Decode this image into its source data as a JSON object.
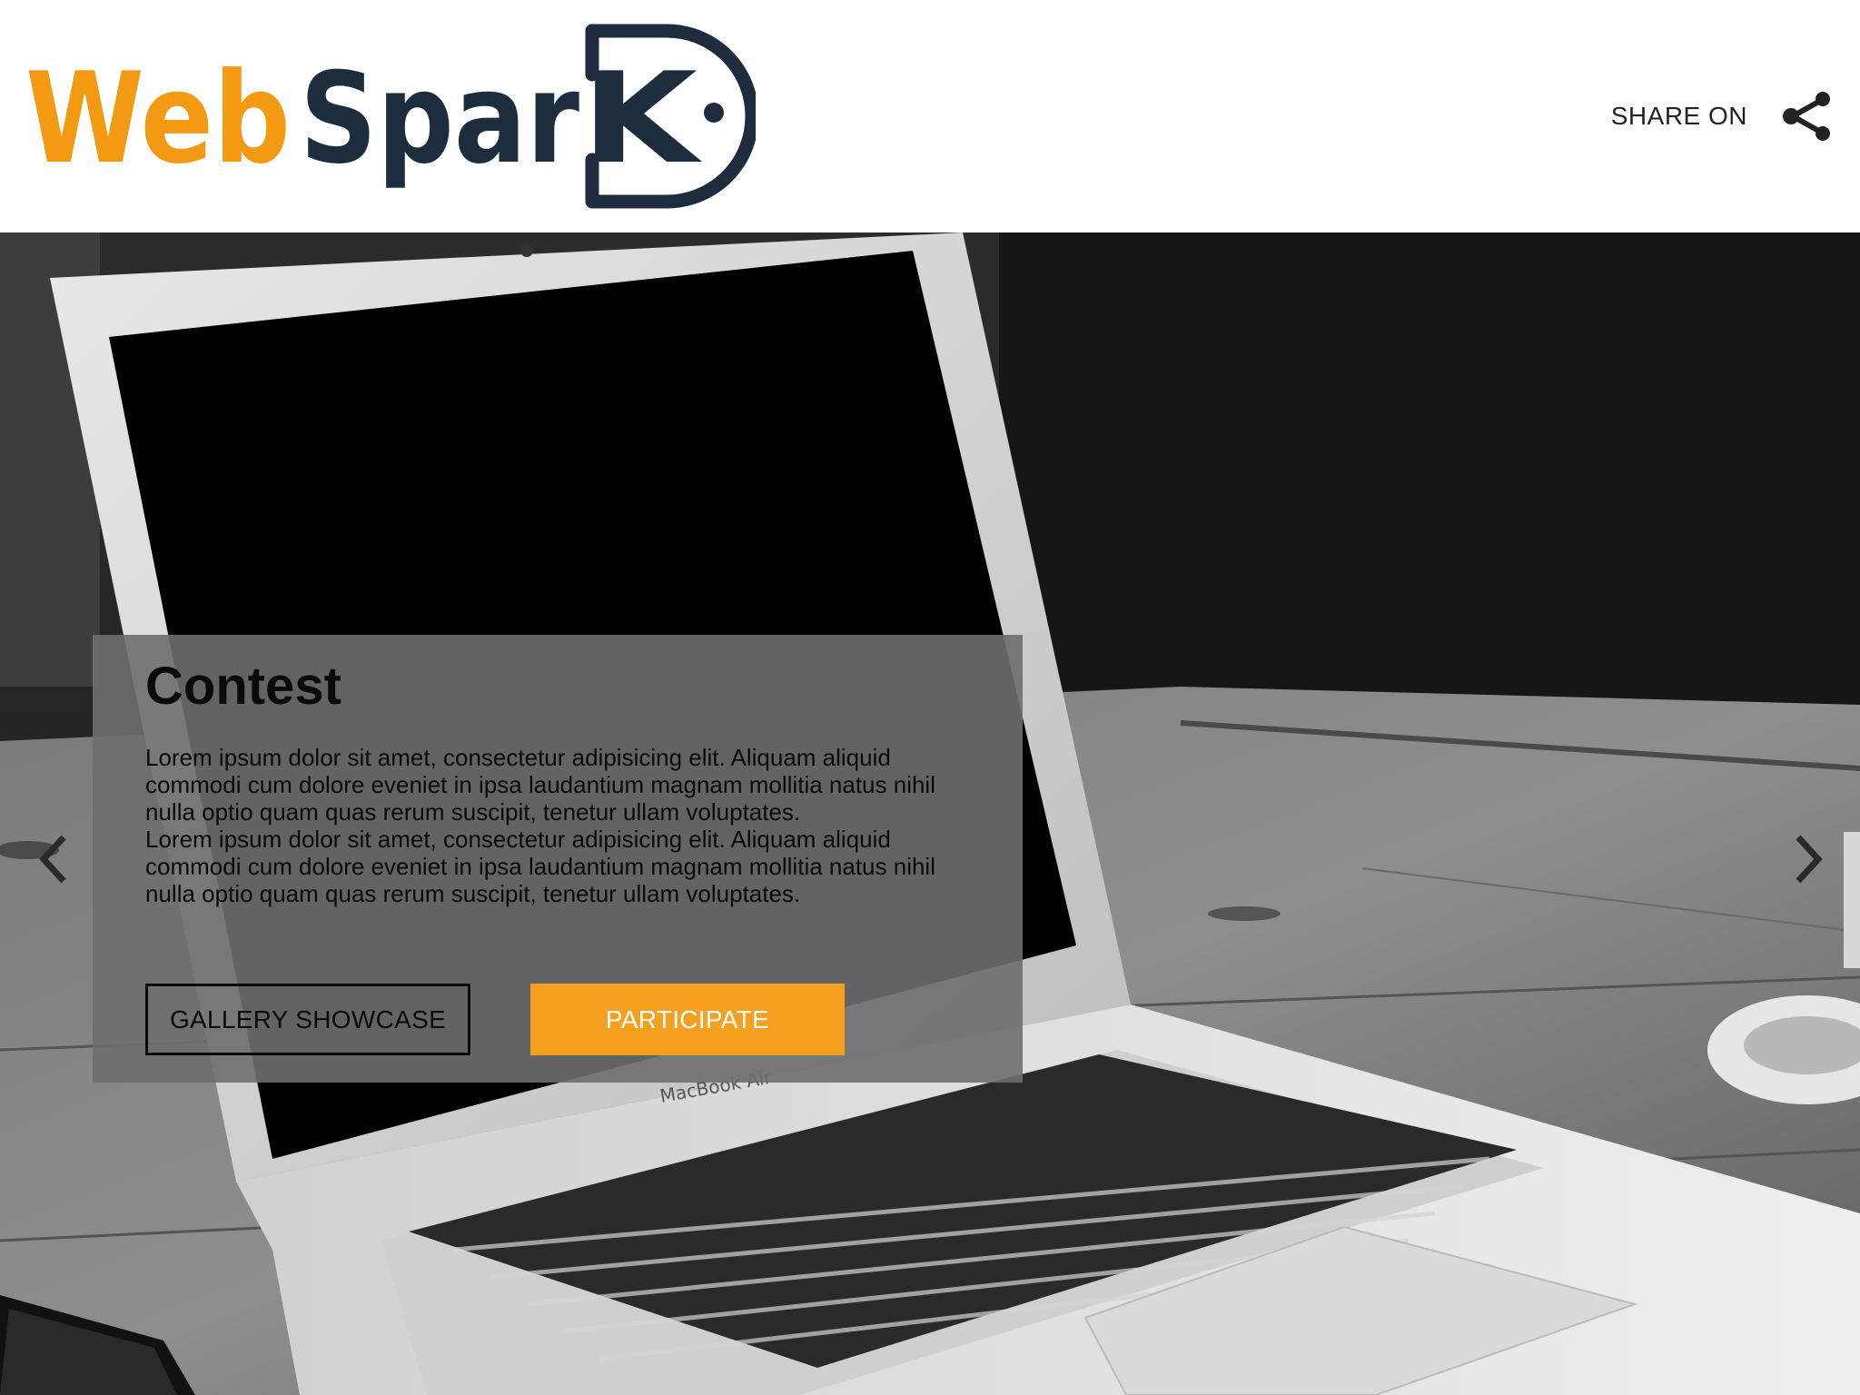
{
  "header": {
    "logo": {
      "text_part1": "Web",
      "text_part2": "Spar",
      "text_part3": "K",
      "color_orange": "#f39a12",
      "color_navy": "#1e2d3d"
    },
    "share_label": "SHARE ON",
    "share_icon": "share-icon"
  },
  "hero": {
    "background": "grayscale photo of a MacBook Air laptop on a wooden table with a coffee cup",
    "laptop_brand": "MacBook Air",
    "prev_icon": "chevron-left-icon",
    "next_icon": "chevron-right-icon"
  },
  "card": {
    "title": "Contest",
    "paragraph_1": "Lorem ipsum dolor sit amet, consectetur adipisicing elit. Aliquam aliquid commodi cum dolore eveniet in ipsa laudantium magnam mollitia natus nihil nulla optio quam quas rerum suscipit, tenetur ullam voluptates.",
    "paragraph_2": "Lorem ipsum dolor sit amet, consectetur adipisicing elit. Aliquam aliquid commodi cum dolore eveniet in ipsa laudantium magnam mollitia natus nihil nulla optio quam quas rerum suscipit, tenetur ullam voluptates.",
    "gallery_button": "GALLERY SHOWCASE",
    "participate_button": "PARTICIPATE",
    "accent_color": "#f5a021"
  }
}
